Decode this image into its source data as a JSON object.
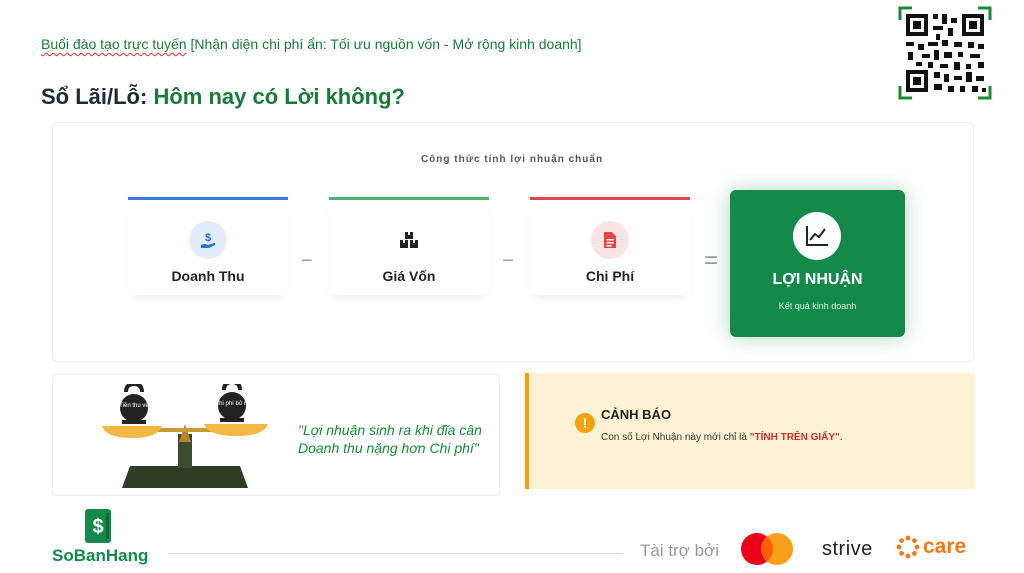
{
  "header": {
    "top_line_prefix": "Buổi đào tạo trực tuyến",
    "top_line_rest": " [Nhận diện chi phí ẩn: Tối ưu nguồn vốn - Mở rộng kinh doanh]",
    "title_prefix": "Sổ Lãi/Lỗ: ",
    "title_highlight": "Hôm nay có Lời không?"
  },
  "formula": {
    "caption": "Công thức tính lợi nhuận chuẩn",
    "cards": [
      {
        "label": "Doanh Thu",
        "icon": "hand-dollar-icon",
        "color": "#3b7be0"
      },
      {
        "label": "Giá Vốn",
        "icon": "boxes-icon",
        "color": "#4caf6a"
      },
      {
        "label": "Chi Phí",
        "icon": "receipt-icon",
        "color": "#e04848"
      }
    ],
    "minus": "−",
    "equals": "=",
    "result": {
      "label": "LỢI NHUẬN",
      "sub": "Kết quả kinh doanh",
      "icon": "trend-chart-icon",
      "color": "#14894a"
    }
  },
  "scale": {
    "left_weight": "Tiền thu về",
    "right_weight": "Chi phí bỏ ra",
    "quote": "\"Lợi nhuận sinh ra khi đĩa cân Doanh thu nặng hơn Chi phí\""
  },
  "warning": {
    "icon": "!",
    "title": "CẢNH BÁO",
    "text_prefix": "Con số Lợi Nhuận này mới chỉ là ",
    "text_highlight": "\"TÍNH TRÊN GIẤY\"",
    "text_suffix": ".",
    "accent": "#f2a10f"
  },
  "footer": {
    "brand": "SoBanHang",
    "sponsor_label": "Tài trợ bởi",
    "partners": [
      "strive",
      "care"
    ]
  }
}
